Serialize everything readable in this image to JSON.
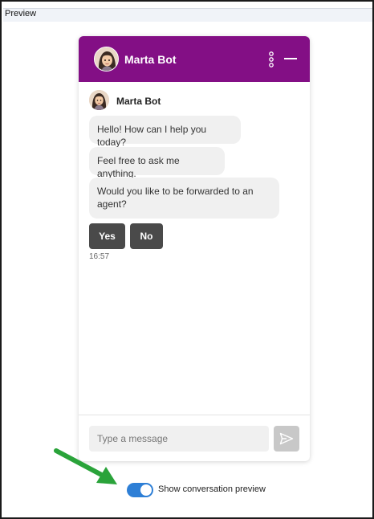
{
  "preview": {
    "label": "Preview"
  },
  "widget": {
    "bot_name": "Marta Bot",
    "header_color": "#830f85",
    "messages": [
      "Hello! How can I help you today?",
      "Feel free to ask me anything.",
      "Would you like to be forwarded to an agent?"
    ],
    "quick_replies": [
      "Yes",
      "No"
    ],
    "timestamp": "16:57",
    "input": {
      "placeholder": "Type a message",
      "value": ""
    },
    "icons": {
      "menu": "kebab-menu-icon",
      "minimize": "minimize-icon",
      "send": "send-icon"
    }
  },
  "toggle": {
    "label": "Show conversation preview",
    "checked": true,
    "color": "#2e7fd6"
  },
  "annotation": {
    "arrow_color": "#2aa33a"
  }
}
